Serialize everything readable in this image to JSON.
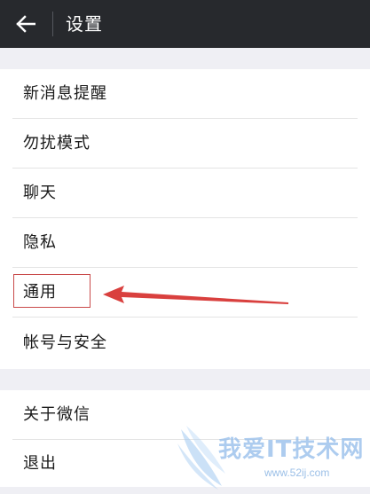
{
  "header": {
    "title": "设置",
    "background": "#27292d",
    "back_icon": "arrow-left-icon"
  },
  "groups": [
    {
      "items": [
        {
          "label": "新消息提醒"
        },
        {
          "label": "勿扰模式"
        },
        {
          "label": "聊天"
        },
        {
          "label": "隐私"
        },
        {
          "label": "通用"
        },
        {
          "label": "帐号与安全"
        }
      ]
    },
    {
      "items": [
        {
          "label": "关于微信"
        },
        {
          "label": "退出"
        }
      ]
    }
  ],
  "annotation": {
    "highlighted_item": "通用",
    "color": "#d9403e"
  },
  "watermark": {
    "text": "我爱IT技术网",
    "url": "www.52ij.com"
  }
}
